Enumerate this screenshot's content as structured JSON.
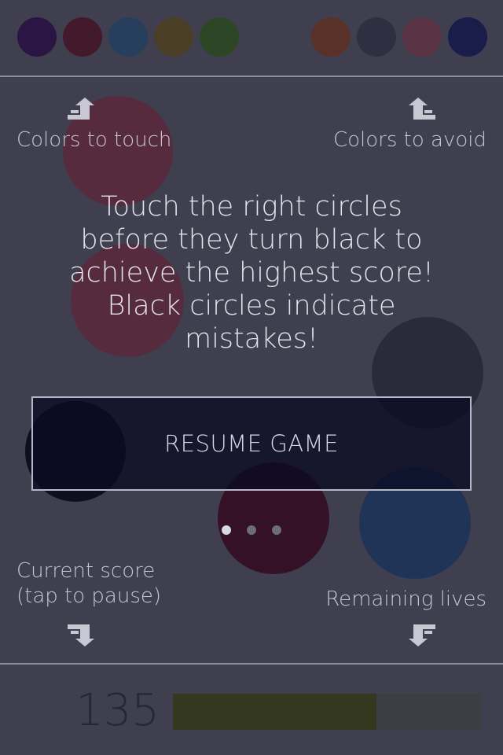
{
  "colors_to_touch": [
    "#2b1543",
    "#431a2c",
    "#253f5c",
    "#4a3f26",
    "#2d4726"
  ],
  "colors_to_avoid": [
    "#5a3128",
    "#2e2f41",
    "#5a3345",
    "#1a1c4a"
  ],
  "labels": {
    "colors_to_touch": "Colors to touch",
    "colors_to_avoid": "Colors to avoid",
    "current_score_line1": "Current score",
    "current_score_line2": "(tap to pause)",
    "remaining_lives": "Remaining lives"
  },
  "instructions": {
    "line1": "Touch the right circles",
    "line2": "before they turn black to",
    "line3": "achieve the highest score!",
    "line4": "Black circles indicate",
    "line5": "mistakes!"
  },
  "resume_button": "RESUME GAME",
  "pager": {
    "count": 3,
    "active_index": 0
  },
  "score": "135",
  "lives_fraction": 0.66,
  "icons": {
    "touch": "arrow-up-right-icon",
    "avoid": "arrow-up-left-icon",
    "score": "arrow-down-left-icon",
    "lives": "arrow-down-right-icon"
  }
}
